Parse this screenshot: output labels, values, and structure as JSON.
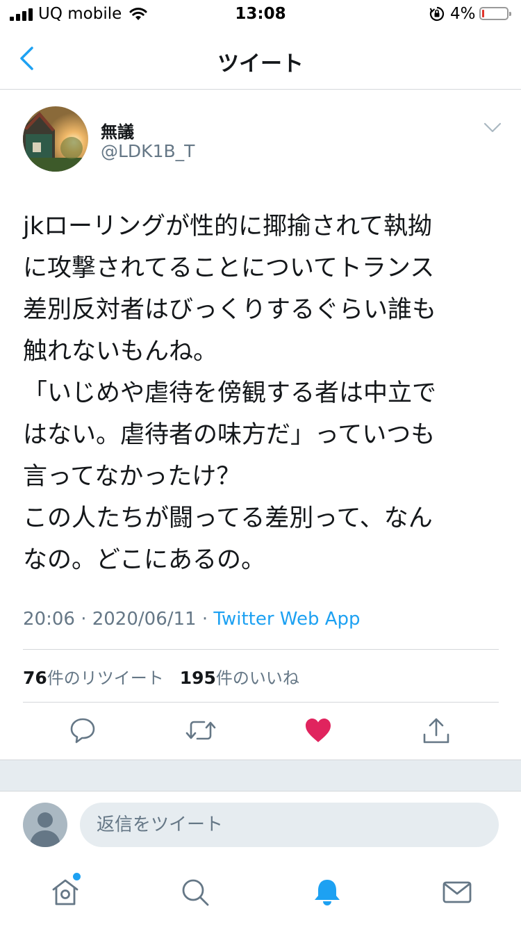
{
  "status_bar": {
    "carrier": "UQ mobile",
    "time": "13:08",
    "battery": "4%"
  },
  "nav": {
    "title": "ツイート"
  },
  "tweet": {
    "name": "無議",
    "handle": "@LDK1B_T",
    "lines": [
      "jkローリングが性的に揶揄されて執拗",
      "に攻撃されてることについてトランス",
      "差別反対者はびっくりするぐらい誰も",
      "触れないもんね。",
      "「いじめや虐待を傍観する者は中立で",
      "はない。虐待者の味方だ」っていつも",
      "言ってなかったけ？",
      "この人たちが闘ってる差別って、なん",
      "なの。どこにあるの。"
    ],
    "time": "20:06 · 2020/06/11 · ",
    "app": "Twitter Web App",
    "retweets_count": "76",
    "retweets_label": "件のリツイート",
    "likes_count": "195",
    "likes_label": "件のいいね",
    "liked": true
  },
  "actions": [
    "reply-icon",
    "retweet-icon",
    "like-icon",
    "share-icon"
  ],
  "reply": {
    "placeholder": "返信をツイート"
  },
  "tab_bar": [
    "home-icon",
    "search-icon",
    "notifications-icon",
    "messages-icon"
  ],
  "colors": {
    "accent": "#1da1f2",
    "like": "#e0245e",
    "secondary_text": "#657786"
  }
}
